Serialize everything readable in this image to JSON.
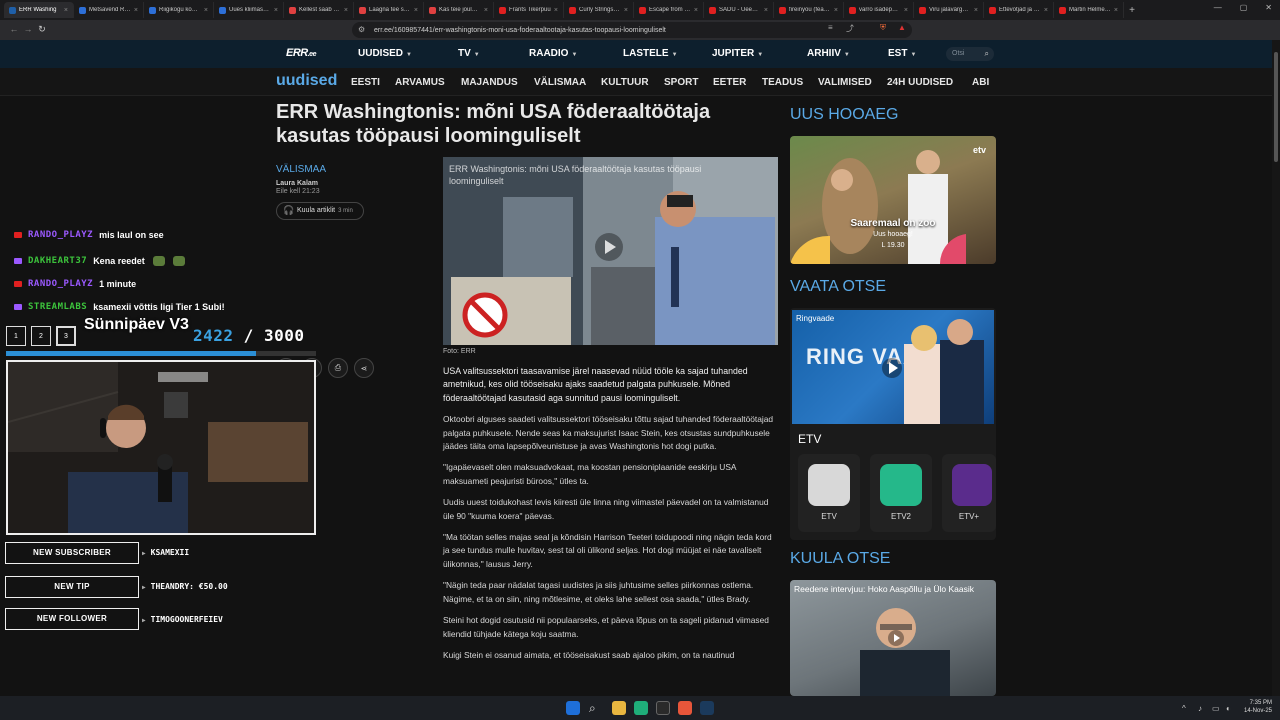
{
  "browser": {
    "tabs": [
      {
        "label": "ERR Washing",
        "color": "#1f5fa8",
        "active": true
      },
      {
        "label": "Metsavend Ruuli",
        "color": "#2d6fd8"
      },
      {
        "label": "Riigikogu komisjo",
        "color": "#2d6fd8"
      },
      {
        "label": "Uues kliimaseadu",
        "color": "#2d6fd8"
      },
      {
        "label": "Kellest saab Tallin",
        "color": "#e04040"
      },
      {
        "label": "Laagna tee surma",
        "color": "#e04040"
      },
      {
        "label": "Kas teie jõuluking",
        "color": "#e04040"
      },
      {
        "label": "Frants Tikerpuu",
        "color": "#e02020"
      },
      {
        "label": "Curly Strings x Ma",
        "color": "#e02020"
      },
      {
        "label": "Escape from Tarko",
        "color": "#e02020"
      },
      {
        "label": "SADU - Ueeks ho",
        "color": "#e02020"
      },
      {
        "label": "fireinyou (feat. Xe",
        "color": "#e02020"
      },
      {
        "label": "varro isadepäeva",
        "color": "#e02020"
      },
      {
        "label": "Viru jalavärgstaja",
        "color": "#e02020"
      },
      {
        "label": "Ettevõtjad ja riigis",
        "color": "#e02020"
      },
      {
        "label": "Martin Helme: E",
        "color": "#e02020"
      }
    ],
    "url": "err.ee/1609857441/err-washingtonis-moni-usa-foderaaltootaja-kasutas-toopausi-loominguliselt"
  },
  "site": {
    "logo": "ERR",
    "logo_suffix": ".ee",
    "main_nav": [
      "UUDISED",
      "TV",
      "RAADIO",
      "LASTELE",
      "JUPITER",
      "ARHIIV",
      "EST"
    ],
    "search_placeholder": "Otsi",
    "brand": "uudised",
    "sub_nav": [
      "EESTI",
      "ARVAMUS",
      "MAJANDUS",
      "VÄLISMAA",
      "KULTUUR",
      "SPORT",
      "EETER",
      "TEADUS",
      "VALIMISED",
      "24H UUDISED",
      "ABI"
    ]
  },
  "article": {
    "headline": "ERR Washingtonis: mõni USA föderaaltöötaja kasutas tööpausi loominguliselt",
    "section": "VÄLISMAA",
    "author": "Laura Kalam",
    "date": "Eile kell 21:23",
    "listen_label": "Kuula artiklit",
    "listen_duration": "3 min",
    "hero_caption": "ERR Washingtonis: mõni USA föderaaltöötaja kasutas tööpausi loominguliselt",
    "photo_credit": "Foto: ERR",
    "paragraphs": [
      "USA valitsussektori taasavamise järel naasevad nüüd tööle ka sajad tuhanded ametnikud, kes olid tööseisaku ajaks saadetud palgata puhkusele. Mõned föderaaltöötajad kasutasid aga sunnitud pausi loominguliselt.",
      "Oktoobri alguses saadeti valitsussektori tööseisaku tõttu sajad tuhanded föderaaltöötajad palgata puhkusele. Nende seas ka maksujurist Isaac Stein, kes otsustas sundpuhkusele jäädes täita oma lapsepõlveunistuse ja avas Washingtonis hot dogi putka.",
      "\"Igapäevaselt olen maksuadvokaat, ma koostan pensioniplaanide eeskirju USA maksuameti peajuristi büroos,\" ütles ta.",
      "Uudis uuest toidukohast levis kiiresti üle linna ning viimastel päevadel on ta valmistanud üle 90 \"kuuma koera\" päevas.",
      "\"Ma töötan selles majas seal ja kõndisin Harrison Teeteri toidupoodi ning nägin teda kord ja see tundus mulle huvitav, sest tal oli ülikond seljas. Hot dogi müüjat ei näe tavaliselt ülikonnas,\" lausus Jerry.",
      "\"Nägin teda paar nädalat tagasi uudistes ja siis juhtusime selles piirkonnas ostlema. Nägime, et ta on siin, ning mõtlesime, et oleks lahe sellest osa saada,\" ütles Brady.",
      "Steini hot dogid osutusid nii populaarseks, et päeva lõpus on ta sageli pidanud viimased kliendid tühjade kätega koju saatma.",
      "Kuigi Stein ei osanud aimata, et tööseisakust saab ajaloo pikim, on ta nautinud"
    ]
  },
  "right": {
    "hooaeg_title": "UUS HOOAEG",
    "hooaeg_badge": "etv",
    "hooaeg_show": "Saaremaal on zoo",
    "hooaeg_sub": "Uus hooaeg!",
    "hooaeg_time": "L 19.30",
    "otse_title": "VAATA OTSE",
    "otse_show": "Ringvaade",
    "otse_bigword": "RING VAADE",
    "otse_channel": "ETV",
    "channels": [
      {
        "label": "ETV",
        "color": "#d8d8d8"
      },
      {
        "label": "ETV2",
        "color": "#25b88a"
      },
      {
        "label": "ETV+",
        "color": "#5a2c8c"
      }
    ],
    "kuula_title": "KUULA OTSE",
    "kuula_caption": "Reedene intervjuu: Hoko Aaspõllu ja Ülo Kaasik"
  },
  "overlay": {
    "chat": [
      {
        "user": "RANDO_PLAYZ",
        "user_color": "#9b59ff",
        "platform_color": "#e02020",
        "msg": "mis laul on see",
        "emotes": 0
      },
      {
        "user": "DAKHEART37",
        "user_color": "#3cc43c",
        "platform_color": "#9b59ff",
        "msg": "Kena reedet",
        "emotes": 2
      },
      {
        "user": "RANDO_PLAYZ",
        "user_color": "#9b59ff",
        "platform_color": "#e02020",
        "msg": "1 minute",
        "emotes": 0
      },
      {
        "user": "STREAMLABS",
        "user_color": "#3cc43c",
        "platform_color": "#9b59ff",
        "msg": "ksamexii võttis ligi Tier 1 Subi!",
        "emotes": 0
      }
    ],
    "goal_boxes": [
      "1",
      "2",
      "3"
    ],
    "goal_title": "Sünnipäev V3",
    "goal_current": "2422",
    "goal_sep": " / ",
    "goal_target": "3000",
    "goal_progress": 0.807,
    "alerts": [
      {
        "label": "NEW SUBSCRIBER",
        "value": "KSAMEXII"
      },
      {
        "label": "NEW TIP",
        "value": "THEANDRY: €50.00"
      },
      {
        "label": "NEW FOLLOWER",
        "value": "TIMOGOONERFEIEV"
      }
    ]
  },
  "taskbar": {
    "time": "7:35 PM",
    "date": "14-Nov-25"
  }
}
